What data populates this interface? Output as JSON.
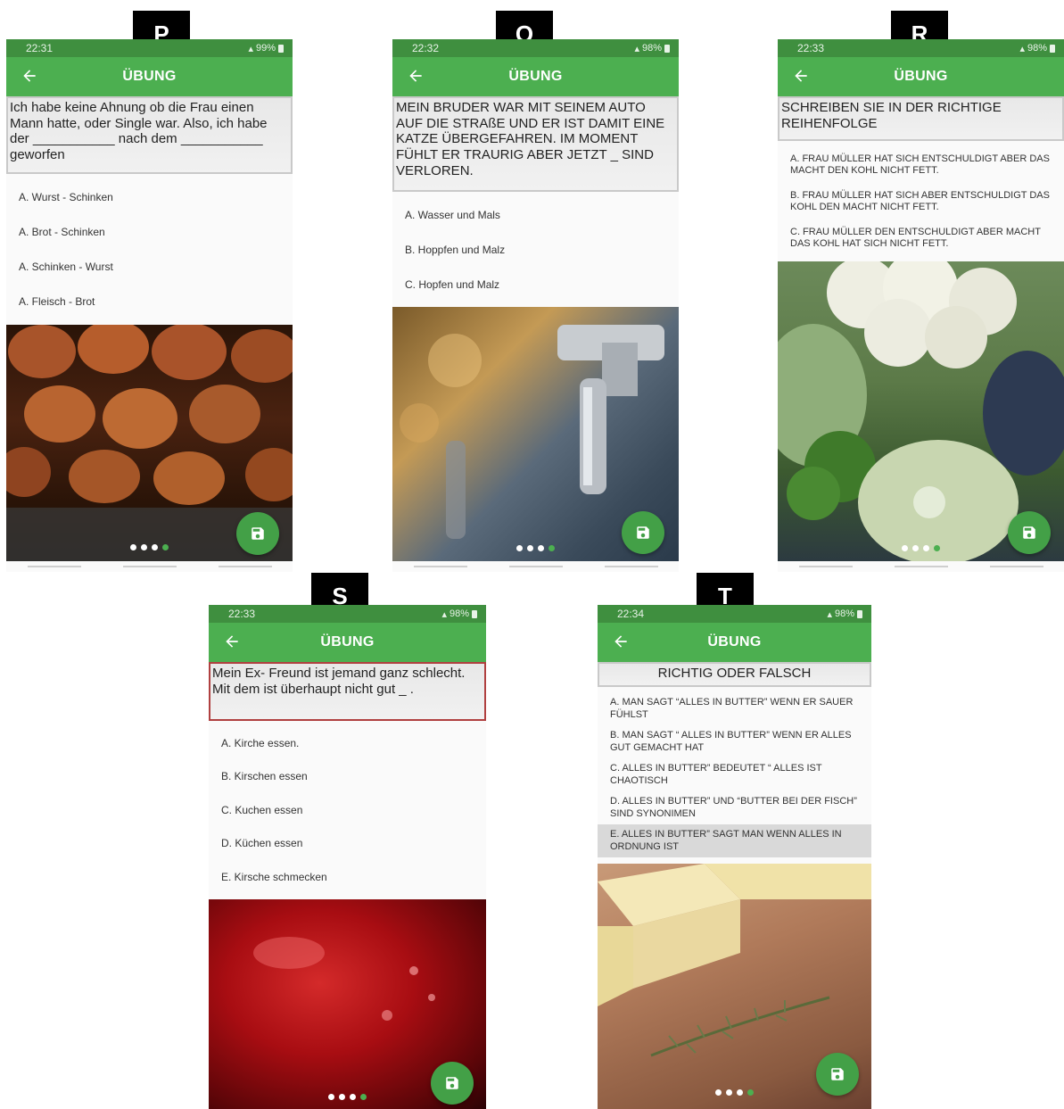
{
  "panels": {
    "P": {
      "label": "P",
      "time": "22:31",
      "battery": "99%",
      "title": "ÜBUNG",
      "question": "Ich habe keine Ahnung ob die Frau einen Mann hatte, oder Single war. Also, ich habe der ___________ nach dem ___________ geworfen",
      "options": [
        "A. Wurst - Schinken",
        "A. Brot - Schinken",
        "A. Schinken - Wurst",
        "A. Fleisch - Brot"
      ],
      "photo": "hazelnuts",
      "dots": 4,
      "active_dot": 4
    },
    "Q": {
      "label": "Q",
      "time": "22:32",
      "battery": "98%",
      "title": "ÜBUNG",
      "question": "MEIN BRUDER WAR MIT SEINEM AUTO AUF DIE STRAßE UND ER IST DAMIT EINE KATZE ÜBERGEFAHREN. IM MOMENT FÜHLT ER TRAURIG ABER JETZT _ SIND VERLOREN.",
      "options": [
        "A. Wasser und Mals",
        "B. Hoppfen und Malz",
        "C. Hopfen und Malz"
      ],
      "photo": "beer-tap",
      "dots": 4,
      "active_dot": 4
    },
    "R": {
      "label": "R",
      "time": "22:33",
      "battery": "98%",
      "title": "ÜBUNG",
      "question": "SCHREIBEN SIE IN DER RICHTIGE REIHENFOLGE",
      "options": [
        "A. FRAU MÜLLER HAT SICH ENTSCHULDIGT ABER DAS MACHT DEN KOHL NICHT FETT.",
        "B. FRAU MÜLLER HAT SICH ABER ENTSCHULDIGT DAS KOHL DEN MACHT NICHT FETT.",
        "C. FRAU MÜLLER DEN ENTSCHULDIGT ABER MACHT DAS KOHL HAT SICH NICHT FETT."
      ],
      "photo": "cabbage",
      "dots": 4,
      "active_dot": 4
    },
    "S": {
      "label": "S",
      "time": "22:33",
      "battery": "98%",
      "title": "ÜBUNG",
      "question": "Mein Ex- Freund ist jemand ganz schlecht. Mit dem ist überhaupt nicht gut _ .",
      "options": [
        "A. Kirche essen.",
        "B. Kirschen essen",
        "C. Kuchen essen",
        "D. Küchen essen",
        "E. Kirsche schmecken"
      ],
      "photo": "cherry",
      "dots": 4,
      "active_dot": 4
    },
    "T": {
      "label": "T",
      "time": "22:34",
      "battery": "98%",
      "title": "ÜBUNG",
      "question": "RICHTIG ODER FALSCH",
      "options": [
        "A. MAN SAGT “ALLES IN BUTTER” WENN ER SAUER FÜHLST",
        "B. MAN SAGT “ ALLES IN BUTTER” WENN ER ALLES GUT GEMACHT HAT",
        "C. ALLES IN BUTTER” BEDEUTET “ ALLES IST CHAOTISCH",
        "D. ALLES IN BUTTER” UND “BUTTER BEI DER FISCH” SIND SYNONIMEN",
        "E. ALLES IN BUTTER” SAGT MAN WENN ALLES IN ORDNUNG IST"
      ],
      "selected_option": 4,
      "photo": "butter",
      "dots": 4,
      "active_dot": 4
    }
  },
  "colors": {
    "appbar": "#4caf50",
    "statusbar": "#3f8f3f",
    "fab": "#43a047"
  },
  "icons": {
    "back": "arrow-left-icon",
    "save": "floppy-disk-icon"
  }
}
